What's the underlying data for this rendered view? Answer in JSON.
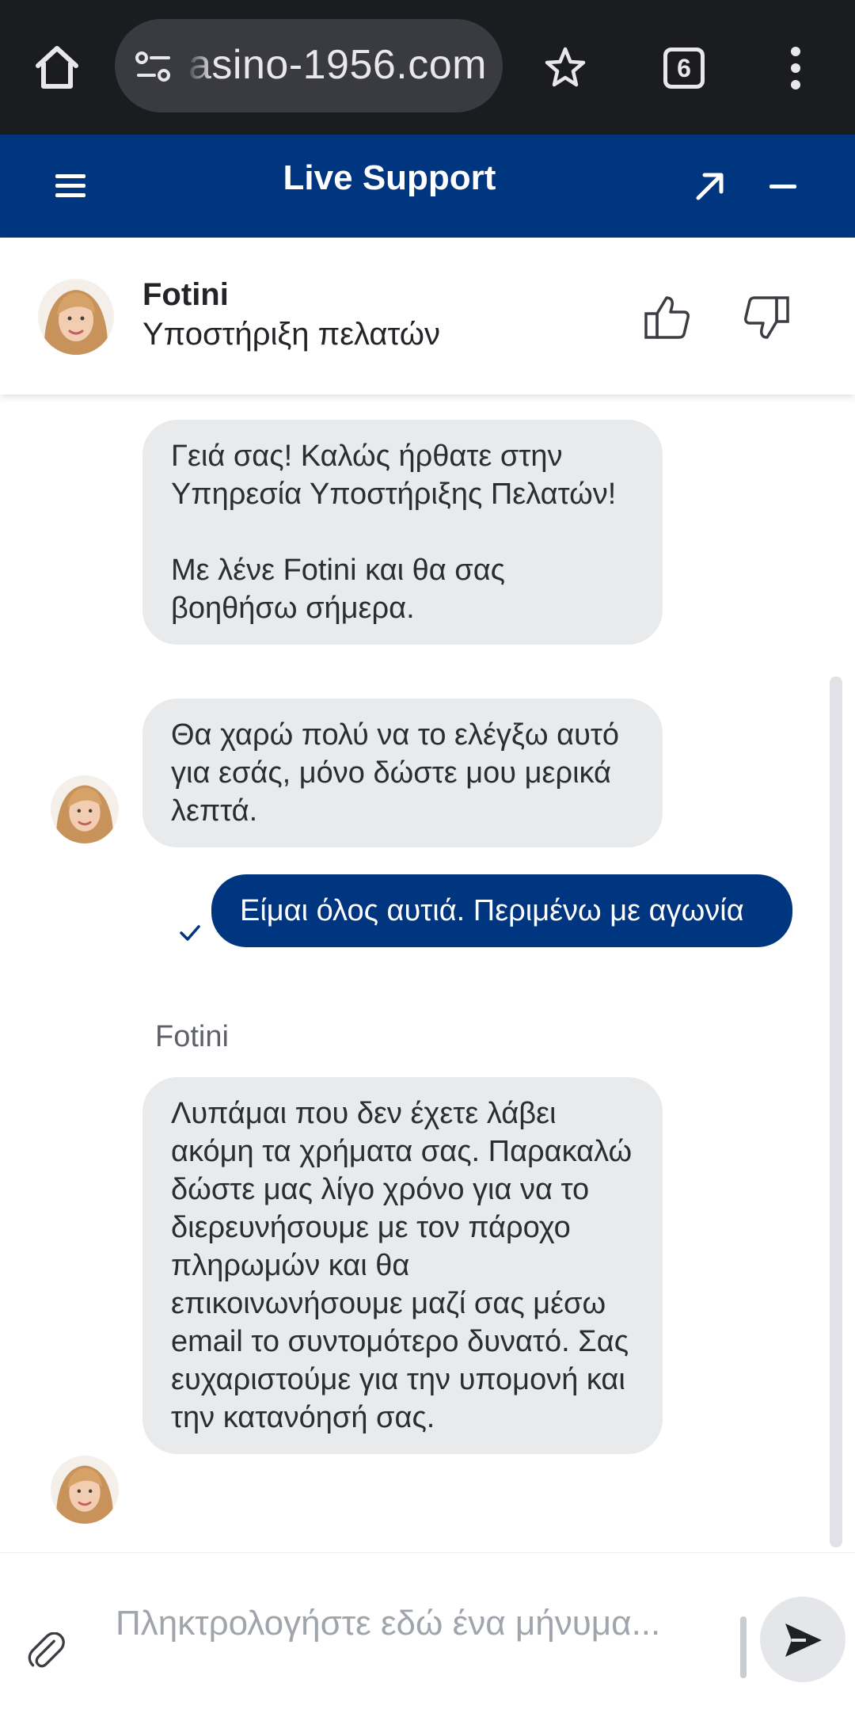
{
  "browser": {
    "url": "asino-1956.com",
    "tab_count": "6",
    "icons": [
      "home-icon",
      "site-settings-icon",
      "star-icon",
      "menu-dots-icon"
    ]
  },
  "header": {
    "title": "Live Support",
    "icons": [
      "hamburger-icon",
      "expand-icon",
      "minimize-icon"
    ],
    "background_color": "#003580"
  },
  "agent": {
    "name": "Fotini",
    "role": "Υποστήριξη πελατών",
    "icons": [
      "thumbs-up-icon",
      "thumbs-down-icon"
    ]
  },
  "messages": [
    {
      "from": "agent",
      "text": "Γειά σας! Καλώς ήρθατε στην Υπηρεσία Υποστήριξης Πελατών!\n\nΜε λένε Fotini και θα σας βοηθήσω σήμερα."
    },
    {
      "from": "agent",
      "text": "Θα χαρώ πολύ να το ελέγξω αυτό για εσάς, μόνο δώστε μου μερικά λεπτά."
    },
    {
      "from": "user",
      "text": "Είμαι όλος αυτιά. Περιμένω με αγωνία",
      "status": "sent"
    },
    {
      "from": "agent",
      "sender": "Fotini",
      "text": "Λυπάμαι που δεν έχετε λάβει ακόμη τα χρήματα σας. Παρακαλώ δώστε μας λίγο χρόνο για να το διερευνήσουμε με τον πάροχο πληρωμών και θα επικοινωνήσουμε μαζί σας μέσω email το συντομότερο δυνατό. Σας ευχαριστούμε για την υπομονή και την κατανόησή σας."
    }
  ],
  "composer": {
    "placeholder": "Πληκτρολογήστε εδώ ένα μήνυμα...",
    "value": "",
    "icons": [
      "attach-icon",
      "send-icon"
    ]
  },
  "colors": {
    "brand": "#003580",
    "agent_bubble": "#e9eaec",
    "user_bubble": "#003580"
  }
}
